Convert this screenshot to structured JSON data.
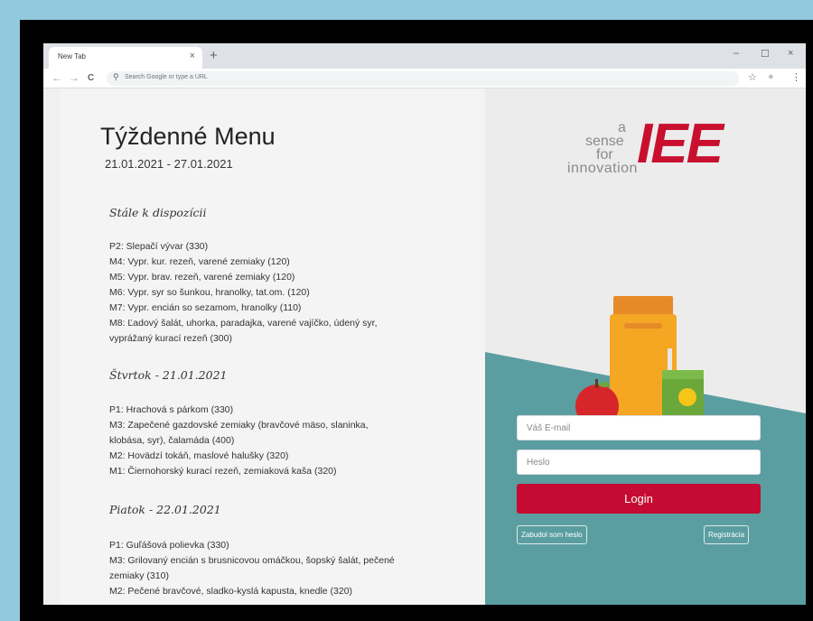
{
  "browser": {
    "tab_title": "New Tab",
    "tab_close": "×",
    "new_tab": "+",
    "minimize": "–",
    "maximize": "☐",
    "close": "×",
    "back": "←",
    "forward": "→",
    "reload": "C",
    "search_icon": "⚲",
    "address_placeholder": "Search Google or type a URL",
    "star": "☆",
    "profile": "●",
    "menu": "⋮"
  },
  "menu": {
    "title": "Týždenné Menu",
    "date_range": "21.01.2021 - 27.01.2021",
    "sections": [
      {
        "title": "Stále k dispozícii",
        "items": [
          "P2: Slepačí vývar (330)",
          "M4: Vypr. kur. rezeň, varené zemiaky (120)",
          "M5: Vypr. brav. rezeň, varené zemiaky (120)",
          "M6: Vypr. syr so šunkou, hranolky, tat.om. (120)",
          "M7: Vypr. encián so sezamom, hranolky (110)",
          "M8: Ľadový šalát, uhorka, paradajka, varené vajíčko, údený syr,",
          "vyprážaný kurací rezeň (300)"
        ]
      },
      {
        "title": "Štvrtok - 21.01.2021",
        "items": [
          "P1: Hrachová s párkom (330)",
          "M3: Zapečené gazdovské zemiaky (bravčové mäso, slaninka,",
          "klobása, syr), čalamáda (400)",
          "M2: Hovädzí tokáň, maslové halušky (320)",
          "M1: Čiernohorský kurací rezeň, zemiaková kaša (320)"
        ]
      },
      {
        "title": "Piatok - 22.01.2021",
        "items": [
          "P1: Guľášová polievka (330)",
          "M3: Grilovaný encián s brusnicovou omáčkou, šopský šalát, pečené",
          "zemiaky (310)",
          "M2: Pečené bravčové, sladko-kyslá kapusta, knedle (320)"
        ]
      }
    ]
  },
  "login": {
    "logo_a": "a",
    "logo_sense": "sense",
    "logo_for": "for",
    "logo_iee": "IEE",
    "logo_innovation": "innovation",
    "email_placeholder": "Váš E-mail",
    "password_placeholder": "Heslo",
    "login_label": "Login",
    "forgot_label": "Zabudol som heslo",
    "register_label": "Registrácia"
  },
  "colors": {
    "teal": "#5a9ea1",
    "brand_red": "#c8102e",
    "login_button": "#c50b31"
  }
}
